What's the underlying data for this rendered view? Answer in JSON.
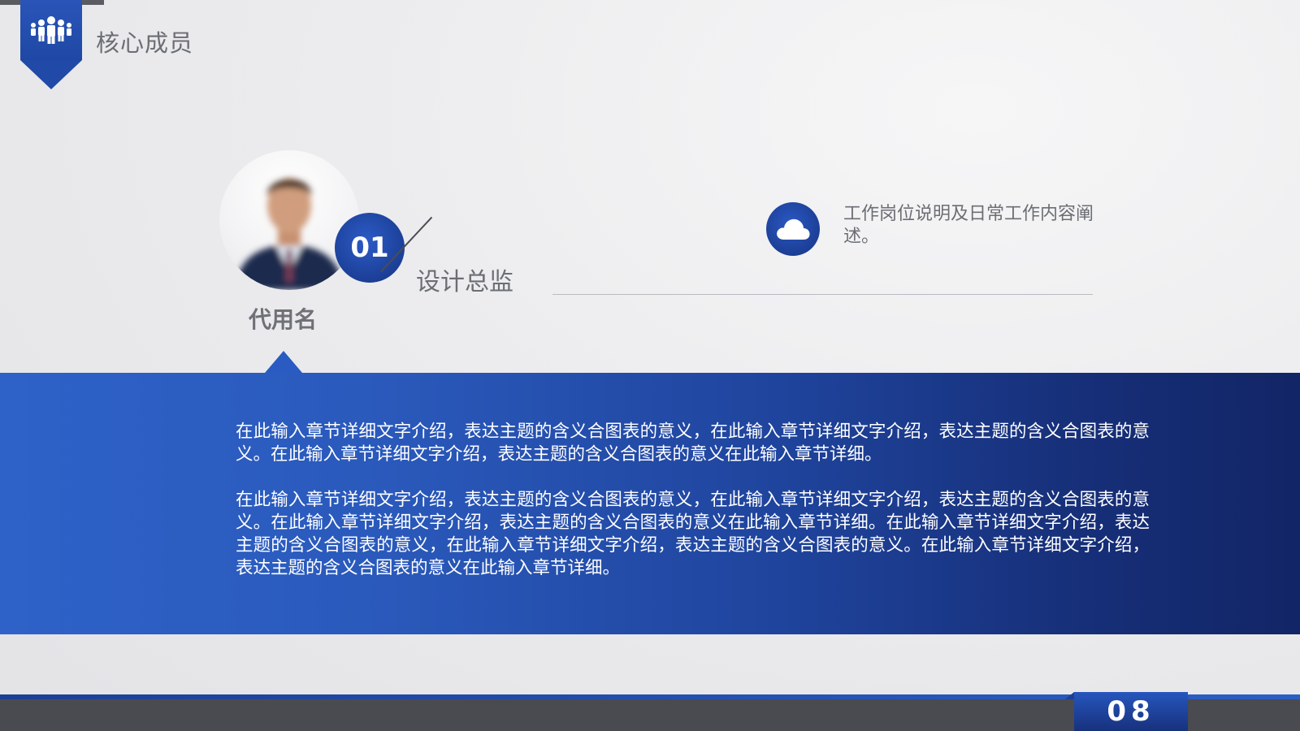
{
  "header": {
    "icon": "team-icon",
    "title": "核心成员"
  },
  "member": {
    "number": "01",
    "role": "设计总监",
    "name": "代用名",
    "photo": "portrait-photo"
  },
  "description": {
    "icon": "cloud-icon",
    "text": "工作岗位说明及日常工作内容阐述。"
  },
  "body": {
    "paragraphs": [
      "在此输入章节详细文字介绍，表达主题的含义合图表的意义，在此输入章节详细文字介绍，表达主题的含义合图表的意义。在此输入章节详细文字介绍，表达主题的含义合图表的意义在此输入章节详细。",
      "在此输入章节详细文字介绍，表达主题的含义合图表的意义，在此输入章节详细文字介绍，表达主题的含义合图表的意义。在此输入章节详细文字介绍，表达主题的含义合图表的意义在此输入章节详细。在此输入章节详细文字介绍，表达主题的含义合图表的意义，在此输入章节详细文字介绍，表达主题的含义合图表的意义。在此输入章节详细文字介绍，表达主题的含义合图表的意义在此输入章节详细。"
    ]
  },
  "footer": {
    "page_number": "08"
  },
  "colors": {
    "accent": "#2a55b8",
    "accent_dark": "#142e72",
    "text_gray": "#6b6e73",
    "footer_bar": "#4a4b50"
  }
}
